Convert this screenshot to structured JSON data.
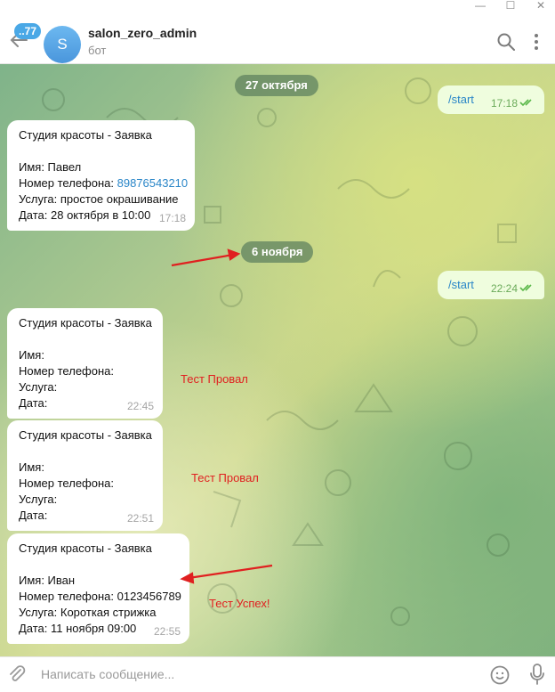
{
  "window": {
    "minimize": "—",
    "maximize": "☐",
    "close": "✕"
  },
  "header": {
    "unread_badge": "..77",
    "avatar_letter": "S",
    "title": "salon_zero_admin",
    "subtitle": "бот"
  },
  "date_separators": [
    "27 октября",
    "6 ноября"
  ],
  "outgoing": [
    {
      "text": "/start",
      "time": "17:18"
    },
    {
      "text": "/start",
      "time": "22:24"
    }
  ],
  "incoming": [
    {
      "title": "Студия красоты - Заявка",
      "name": "Имя: Павел",
      "phone_label": "Номер телефона: ",
      "phone_value": "89876543210",
      "service": "Услуга: простое окрашивание",
      "date": "Дата: 28 октября в 10:00",
      "time": "17:18"
    },
    {
      "title": "Студия красоты - Заявка",
      "name": "Имя:",
      "phone_label": "Номер телефона:",
      "service": "Услуга:",
      "date": "Дата:",
      "time": "22:45"
    },
    {
      "title": "Студия красоты - Заявка",
      "name": "Имя:",
      "phone_label": "Номер телефона:",
      "service": "Услуга:",
      "date": "Дата:",
      "time": "22:51"
    },
    {
      "title": "Студия красоты - Заявка",
      "name": "Имя: Иван",
      "phone_label": "Номер телефона: 0123456789",
      "service": "Услуга: Короткая стрижка",
      "date": "Дата: 11 ноября 09:00",
      "time": "22:55"
    }
  ],
  "annotations": [
    "Тест Провал",
    "Тест Провал",
    "Тест Успех!"
  ],
  "composer": {
    "placeholder": "Написать сообщение..."
  },
  "colors": {
    "accent": "#4aa8e6",
    "outgoing_bubble": "#effdde",
    "annotation": "#e02020"
  }
}
